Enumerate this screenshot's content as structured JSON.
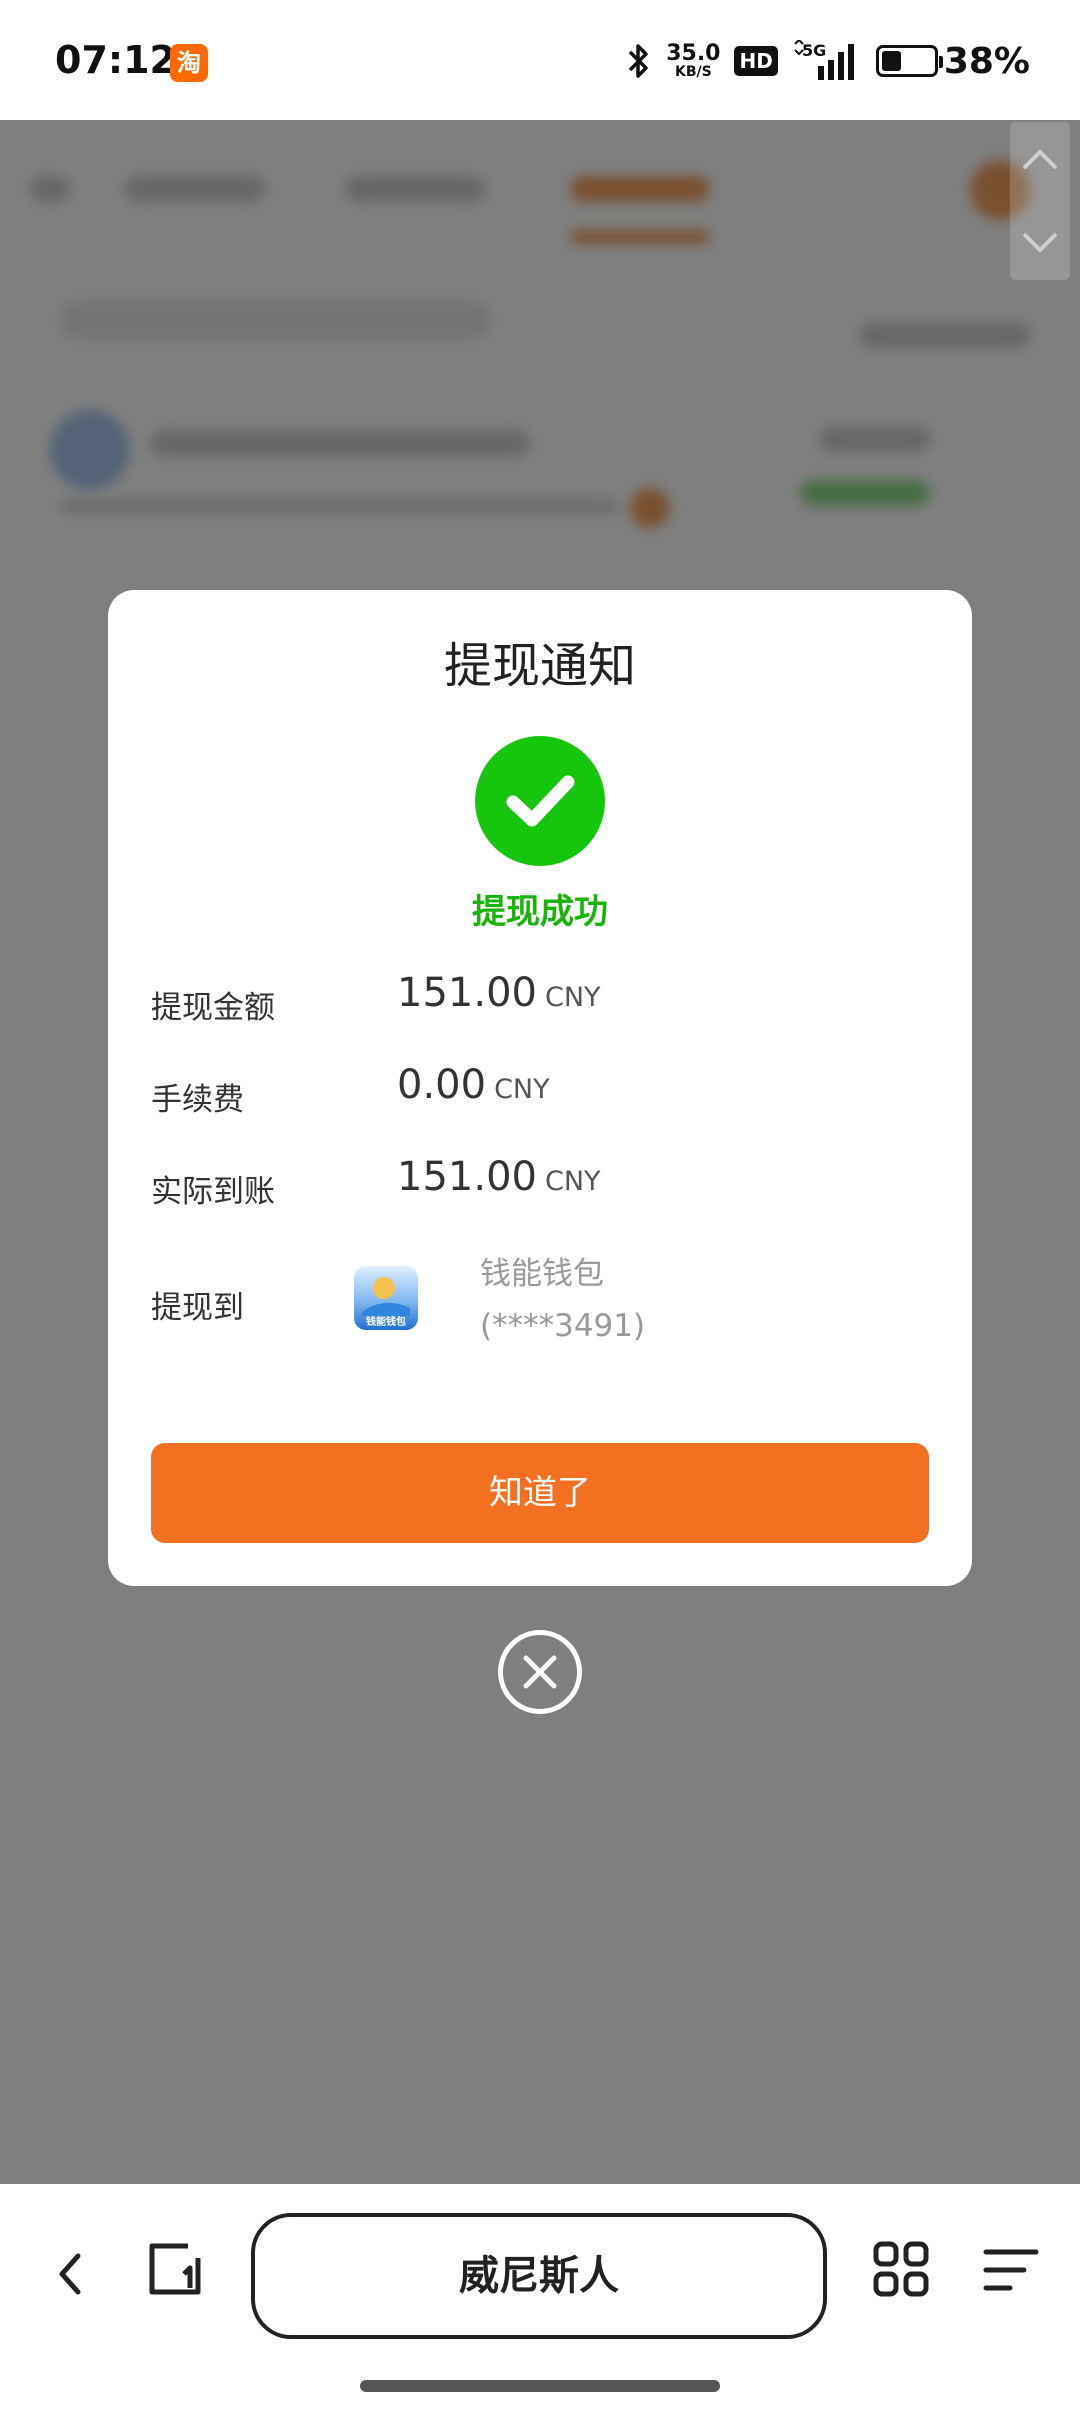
{
  "status_bar": {
    "time": "07:12",
    "app_icon_glyph": "淘",
    "net_speed_value": "35.0",
    "net_speed_unit": "KB/S",
    "hd_label": "HD",
    "network": "5G",
    "battery_percent": "38%",
    "battery_level": 0.38
  },
  "dialog": {
    "title": "提现通知",
    "success_text": "提现成功",
    "rows": [
      {
        "label": "提现金额",
        "value": "151.00",
        "currency": "CNY"
      },
      {
        "label": "手续费",
        "value": "0.00",
        "currency": "CNY"
      },
      {
        "label": "实际到账",
        "value": "151.00",
        "currency": "CNY"
      }
    ],
    "withdraw_to_label": "提现到",
    "wallet_name": "钱能钱包",
    "wallet_account": "(****3491)",
    "wallet_icon_text": "钱能钱包",
    "confirm_button": "知道了"
  },
  "bottom_nav": {
    "url_title": "威尼斯人"
  },
  "colors": {
    "accent_orange": "#f37021",
    "success_green": "#16c60c",
    "overlay": "rgba(0,0,0,0.5)"
  }
}
